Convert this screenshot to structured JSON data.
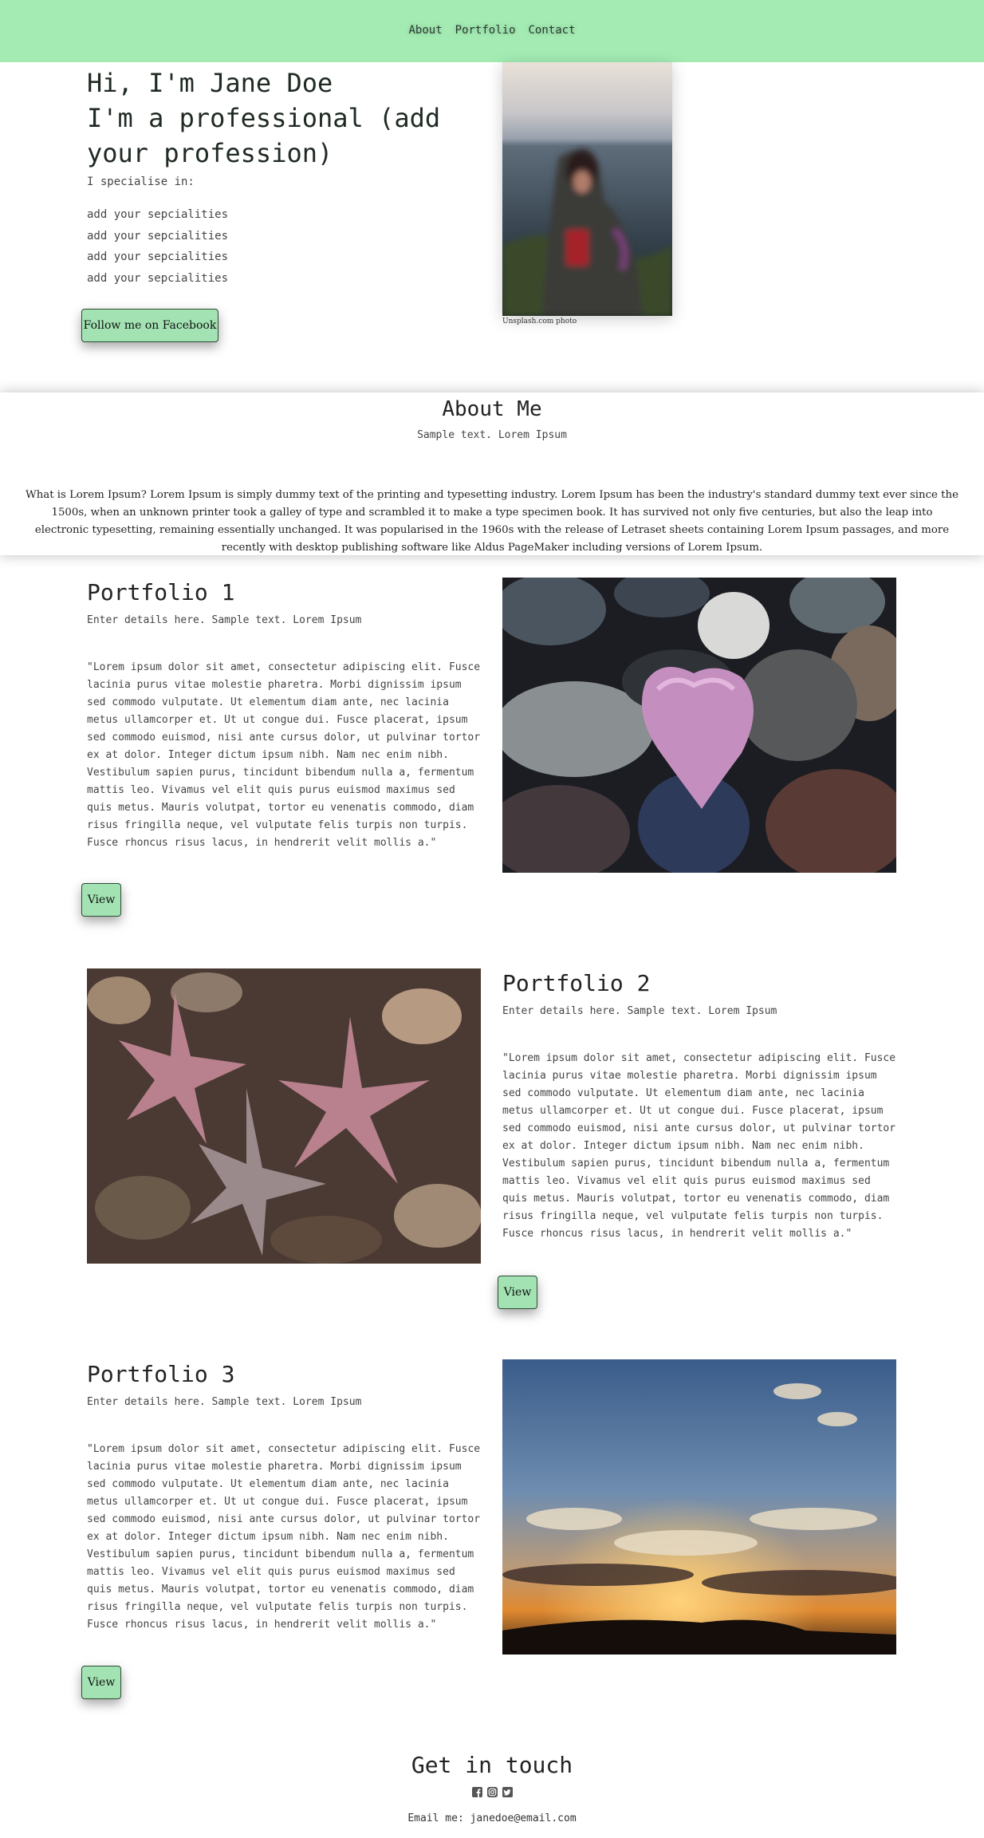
{
  "nav": {
    "items": [
      "About",
      "Portfolio",
      "Contact"
    ]
  },
  "hero": {
    "heading_lines": [
      "Hi, I'm Jane Doe",
      "I'm a professional (add",
      "your profession)"
    ],
    "specialise_label": "I specialise in:",
    "specialities": [
      "add your sepcialities",
      "add your sepcialities",
      "add your sepcialities",
      "add your sepcialities"
    ],
    "facebook_button": "Follow me on Facebook",
    "photo_caption": "Unsplash.com photo"
  },
  "about": {
    "title": "About Me",
    "subtitle": "Sample text. Lorem Ipsum",
    "body": "What is Lorem Ipsum? Lorem Ipsum is simply dummy text of the printing and typesetting industry. Lorem Ipsum has been the industry's standard dummy text ever since the 1500s, when an unknown printer took a galley of type and scrambled it to make a type specimen book. It has survived not only five centuries, but also the leap into electronic typesetting, remaining essentially unchanged. It was popularised in the 1960s with the release of Letraset sheets containing Lorem Ipsum passages, and more recently with desktop publishing software like Aldus PageMaker including versions of Lorem Ipsum."
  },
  "portfolio": [
    {
      "title": "Portfolio 1",
      "subtitle": "Enter details here. Sample text. Lorem Ipsum",
      "body": "\"Lorem ipsum dolor sit amet, consectetur adipiscing elit. Fusce lacinia purus vitae molestie pharetra. Morbi dignissim ipsum sed commodo vulputate. Ut elementum diam ante, nec lacinia metus ullamcorper et. Ut ut congue dui. Fusce placerat, ipsum sed commodo euismod, nisi ante cursus dolor, ut pulvinar tortor ex at dolor. Integer dictum ipsum nibh. Nam nec enim nibh. Vestibulum sapien purus, tincidunt bibendum nulla a, fermentum mattis leo. Vivamus vel elit quis purus euismod maximus sed quis metus. Mauris volutpat, tortor eu venenatis commodo, diam risus fringilla neque, vel vulputate felis turpis non turpis. Fusce rhoncus risus lacus, in hendrerit velit mollis a.\"",
      "button": "View"
    },
    {
      "title": "Portfolio 2",
      "subtitle": "Enter details here. Sample text. Lorem Ipsum",
      "body": "\"Lorem ipsum dolor sit amet, consectetur adipiscing elit. Fusce lacinia purus vitae molestie pharetra. Morbi dignissim ipsum sed commodo vulputate. Ut elementum diam ante, nec lacinia metus ullamcorper et. Ut ut congue dui. Fusce placerat, ipsum sed commodo euismod, nisi ante cursus dolor, ut pulvinar tortor ex at dolor. Integer dictum ipsum nibh. Nam nec enim nibh. Vestibulum sapien purus, tincidunt bibendum nulla a, fermentum mattis leo. Vivamus vel elit quis purus euismod maximus sed quis metus. Mauris volutpat, tortor eu venenatis commodo, diam risus fringilla neque, vel vulputate felis turpis non turpis. Fusce rhoncus risus lacus, in hendrerit velit mollis a.\"",
      "button": "View"
    },
    {
      "title": "Portfolio 3",
      "subtitle": "Enter details here. Sample text. Lorem Ipsum",
      "body": "\"Lorem ipsum dolor sit amet, consectetur adipiscing elit. Fusce lacinia purus vitae molestie pharetra. Morbi dignissim ipsum sed commodo vulputate. Ut elementum diam ante, nec lacinia metus ullamcorper et. Ut ut congue dui. Fusce placerat, ipsum sed commodo euismod, nisi ante cursus dolor, ut pulvinar tortor ex at dolor. Integer dictum ipsum nibh. Nam nec enim nibh. Vestibulum sapien purus, tincidunt bibendum nulla a, fermentum mattis leo. Vivamus vel elit quis purus euismod maximus sed quis metus. Mauris volutpat, tortor eu venenatis commodo, diam risus fringilla neque, vel vulputate felis turpis non turpis. Fusce rhoncus risus lacus, in hendrerit velit mollis a.\"",
      "button": "View"
    }
  ],
  "contact": {
    "title": "Get in touch",
    "social_icons": [
      "facebook-icon",
      "instagram-icon",
      "twitter-icon"
    ],
    "email_line": "Email me: janedoe@email.com"
  },
  "colors": {
    "accent_green": "#a3ebb3",
    "button_green": "#a3e3b3",
    "button_border": "#2e4c36"
  }
}
